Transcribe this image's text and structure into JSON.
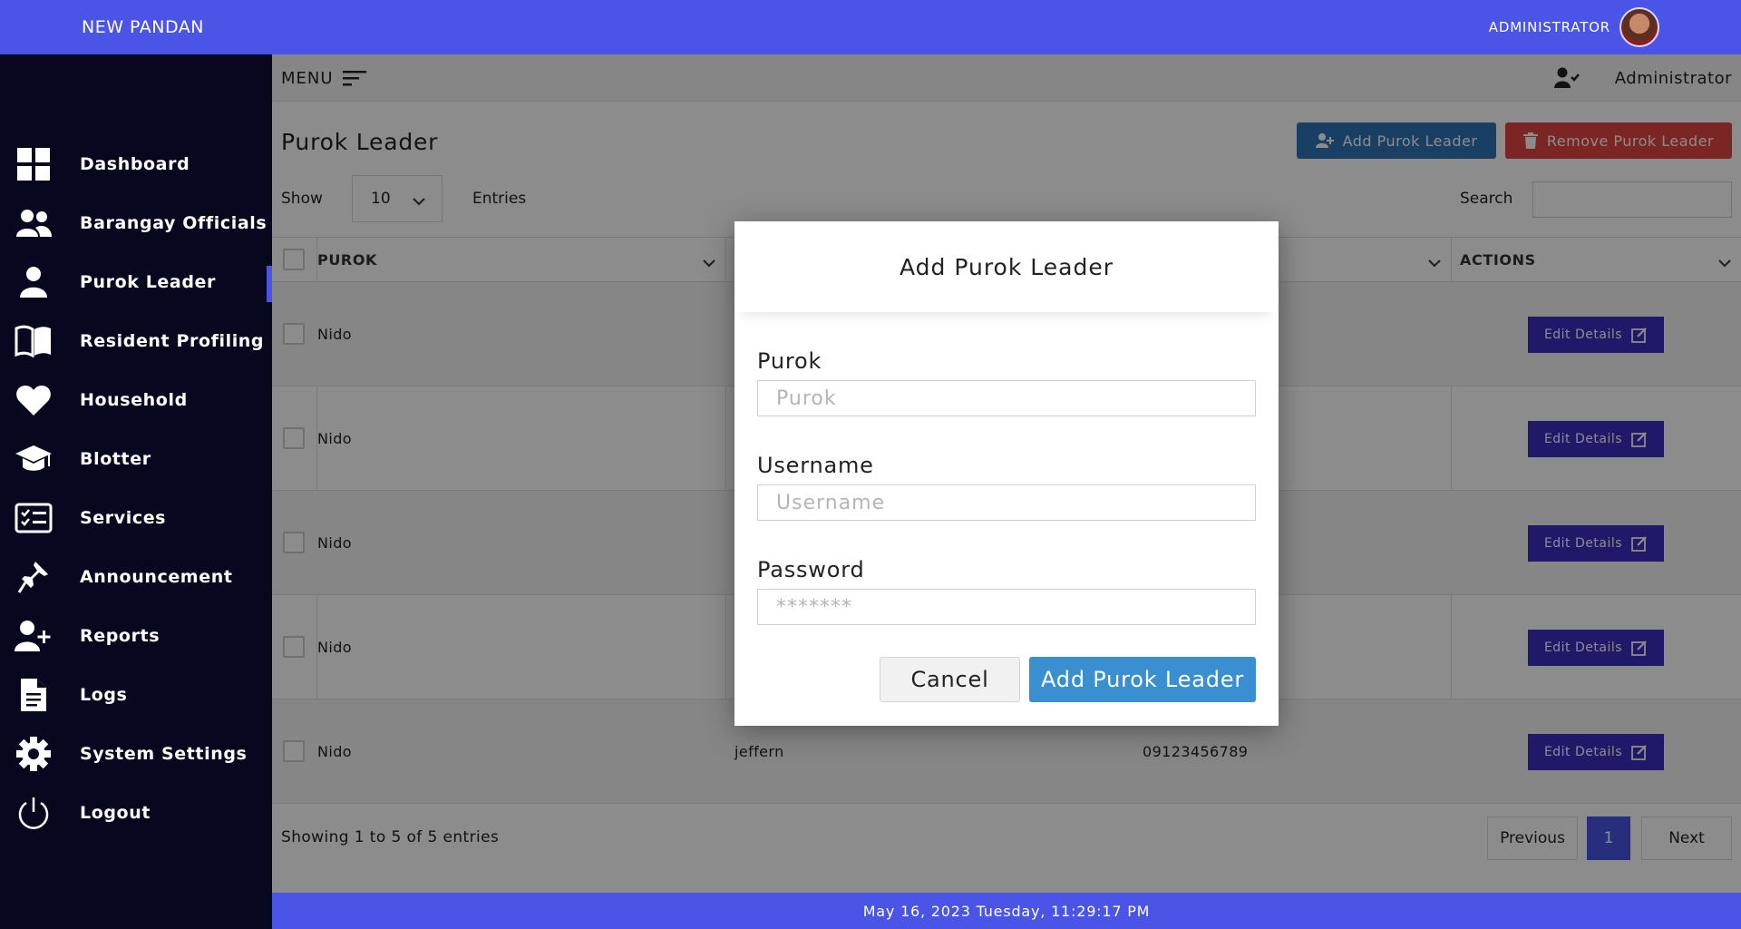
{
  "topbar": {
    "brand": "NEW PANDAN",
    "admin_label": "ADMINISTRATOR"
  },
  "colors": {
    "primary": "#4a54e6",
    "sidebar_bg": "#07071f",
    "add_button": "#2e73b8",
    "remove_button": "#e14444",
    "edit_button": "#3b2fbf",
    "modal_submit": "#3a8fd0"
  },
  "sidebar": {
    "items": [
      {
        "label": "Dashboard",
        "icon": "dashboard-grid-icon"
      },
      {
        "label": "Barangay Officials",
        "icon": "users-group-icon"
      },
      {
        "label": "Purok Leader",
        "icon": "user-icon",
        "active": true
      },
      {
        "label": "Resident Profiling",
        "icon": "book-open-icon"
      },
      {
        "label": "Household",
        "icon": "heart-icon"
      },
      {
        "label": "Blotter",
        "icon": "graduation-cap-icon"
      },
      {
        "label": "Services",
        "icon": "checklist-icon"
      },
      {
        "label": "Announcement",
        "icon": "pin-icon"
      },
      {
        "label": "Reports",
        "icon": "user-plus-icon"
      },
      {
        "label": "Logs",
        "icon": "document-icon"
      },
      {
        "label": "System Settings",
        "icon": "gear-icon"
      },
      {
        "label": "Logout",
        "icon": "power-icon"
      }
    ]
  },
  "menubar": {
    "menu_label": "MENU",
    "user_name": "Administrator"
  },
  "page": {
    "title": "Purok Leader",
    "add_button": "Add Purok Leader",
    "remove_button": "Remove Purok Leader",
    "show_label": "Show",
    "entries_value": "10",
    "entries_label": "Entries",
    "search_label": "Search"
  },
  "table": {
    "headers": [
      "PUROK",
      "",
      "",
      "ACTIONS"
    ],
    "rows": [
      {
        "purok": "Nido",
        "username": "",
        "contact": "",
        "action": "Edit Details"
      },
      {
        "purok": "Nido",
        "username": "",
        "contact": "",
        "action": "Edit Details"
      },
      {
        "purok": "Nido",
        "username": "",
        "contact": "",
        "action": "Edit Details"
      },
      {
        "purok": "Nido",
        "username": "",
        "contact": "",
        "action": "Edit Details"
      },
      {
        "purok": "Nido",
        "username": "jeffern",
        "contact": "09123456789",
        "action": "Edit Details"
      }
    ]
  },
  "pagination": {
    "showing": "Showing 1 to 5 of 5 entries",
    "previous": "Previous",
    "current": "1",
    "next": "Next"
  },
  "footer": {
    "datetime": "May 16, 2023 Tuesday, 11:29:17 PM"
  },
  "modal": {
    "title": "Add Purok Leader",
    "purok_label": "Purok",
    "purok_placeholder": "Purok",
    "username_label": "Username",
    "username_placeholder": "Username",
    "password_label": "Password",
    "password_placeholder": "*******",
    "cancel": "Cancel",
    "submit": "Add Purok Leader"
  }
}
